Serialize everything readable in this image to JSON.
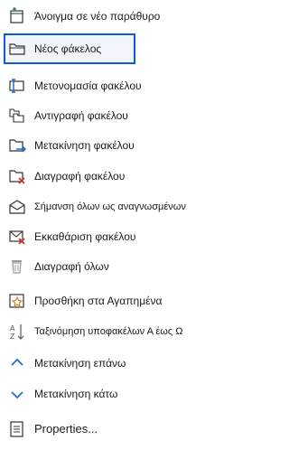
{
  "menu": {
    "items": [
      {
        "label": "Άνοιγμα σε νέο παράθυρο",
        "icon": "open-new-window-icon"
      },
      {
        "label": "Νέος φάκελος",
        "icon": "new-folder-icon",
        "selected": true
      },
      {
        "label": "Μετονομασία φακέλου",
        "icon": "rename-folder-icon"
      },
      {
        "label": "Αντιγραφή φακέλου",
        "icon": "copy-folder-icon"
      },
      {
        "label": "Μετακίνηση φακέλου",
        "icon": "move-folder-icon"
      },
      {
        "label": "Διαγραφή φακέλου",
        "icon": "delete-folder-icon"
      },
      {
        "label": "Σήμανση όλων ως αναγνωσμένων",
        "icon": "mark-all-read-icon"
      },
      {
        "label": "Εκκαθάριση φακέλου",
        "icon": "clean-up-folder-icon"
      },
      {
        "label": "Διαγραφή όλων",
        "icon": "delete-all-icon"
      },
      {
        "label": "Προσθήκη στα Αγαπημένα",
        "icon": "add-to-favorites-icon"
      },
      {
        "label": "Ταξινόμηση υποφακέλων Α έως Ω",
        "icon": "sort-a-z-icon"
      },
      {
        "label": "Μετακίνηση επάνω",
        "icon": "move-up-icon"
      },
      {
        "label": "Μετακίνηση κάτω",
        "icon": "move-down-icon"
      },
      {
        "label": "Properties...",
        "icon": "properties-icon"
      }
    ]
  },
  "colors": {
    "selection_border": "#0f5bd4",
    "icon_line": "#333333",
    "icon_accent_green": "#2e8b3a",
    "icon_accent_blue": "#1f6fd1",
    "icon_accent_red": "#c8312a",
    "icon_accent_orange": "#d9822b"
  }
}
